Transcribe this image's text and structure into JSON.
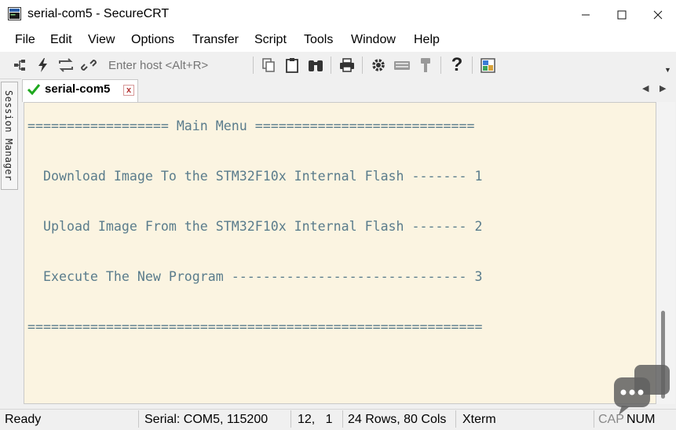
{
  "window": {
    "title": "serial-com5 - SecureCRT"
  },
  "menu": [
    "File",
    "Edit",
    "View",
    "Options",
    "Transfer",
    "Script",
    "Tools",
    "Window",
    "Help"
  ],
  "toolbar": {
    "host_placeholder": "Enter host <Alt+R>",
    "icons": [
      "connect-icon",
      "quick-connect-icon",
      "reconnect-icon",
      "disconnect-icon",
      "copy-icon",
      "paste-icon",
      "find-icon",
      "print-icon",
      "settings-icon",
      "keymap-icon",
      "key-icon",
      "help-icon",
      "sftp-icon"
    ]
  },
  "session_manager": {
    "label": "Session Manager"
  },
  "tab": {
    "label": "serial-com5",
    "close": "x"
  },
  "terminal": {
    "lines": [
      "================== Main Menu ============================",
      "",
      "  Download Image To the STM32F10x Internal Flash ------- 1",
      "",
      "  Upload Image From the STM32F10x Internal Flash ------- 2",
      "",
      "  Execute The New Program ------------------------------ 3",
      "",
      "=========================================================="
    ]
  },
  "status": {
    "ready": "Ready",
    "serial": "Serial: COM5, 115200",
    "cursor": "12,   1",
    "size": "24 Rows, 80 Cols",
    "emulation": "Xterm",
    "cap": "CAP",
    "num": "NUM"
  },
  "colors": {
    "terminal_bg": "#fbf4e1",
    "terminal_text": "#5a7c8c",
    "tab_check": "#1fa81f"
  }
}
